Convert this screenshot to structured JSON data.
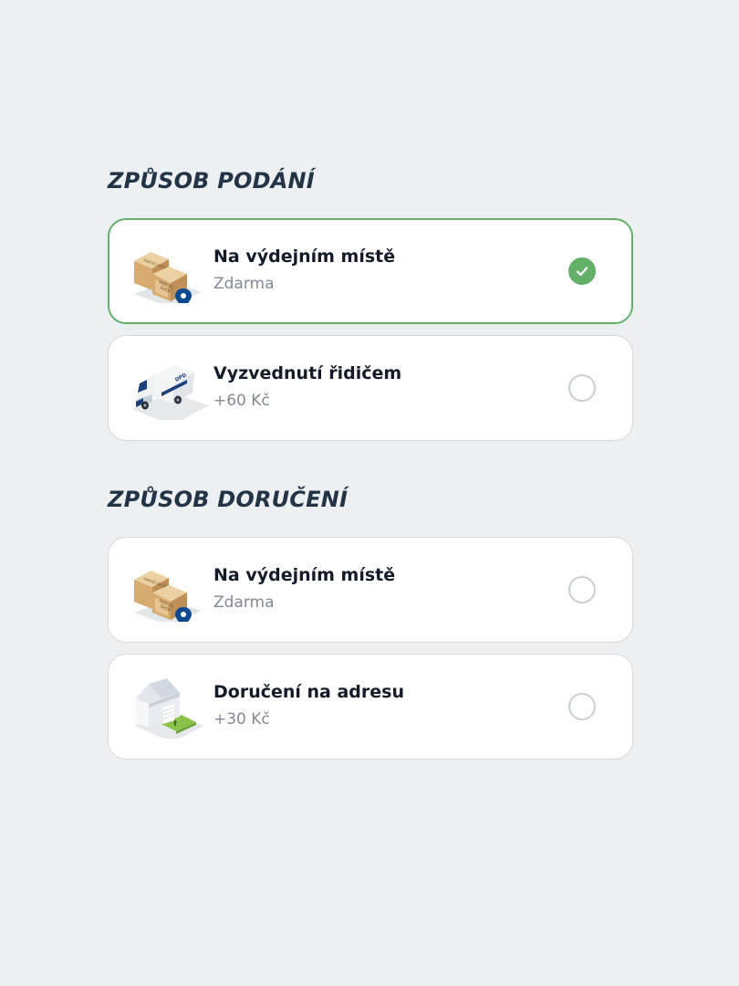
{
  "colors": {
    "background": "#edf0f3",
    "card": "#ffffff",
    "selected_border": "#63b069",
    "check_fill": "#63b069",
    "title": "#243447",
    "label": "#131b2b",
    "price": "#808a96",
    "pin": "#0b4a8f"
  },
  "submission": {
    "title": "ZPŮSOB PODÁNÍ",
    "options": [
      {
        "label": "Na výdejním místě",
        "price": "Zdarma",
        "icon": "parcelshop-boxes-pin-icon",
        "selected": true
      },
      {
        "label": "Vyzvednutí řidičem",
        "price": "+60 Kč",
        "icon": "delivery-van-icon",
        "selected": false
      }
    ]
  },
  "delivery": {
    "title": "ZPŮSOB DORUČENÍ",
    "options": [
      {
        "label": "Na výdejním místě",
        "price": "Zdarma",
        "icon": "parcelshop-boxes-pin-icon",
        "selected": false
      },
      {
        "label": "Doručení na adresu",
        "price": "+30 Kč",
        "icon": "house-icon",
        "selected": false
      }
    ]
  },
  "icon_texts": {
    "box_back": "PARCELSHOP",
    "box_front_line1": "PARCEL",
    "box_front_line2": "SHOP",
    "van": "DPD"
  }
}
